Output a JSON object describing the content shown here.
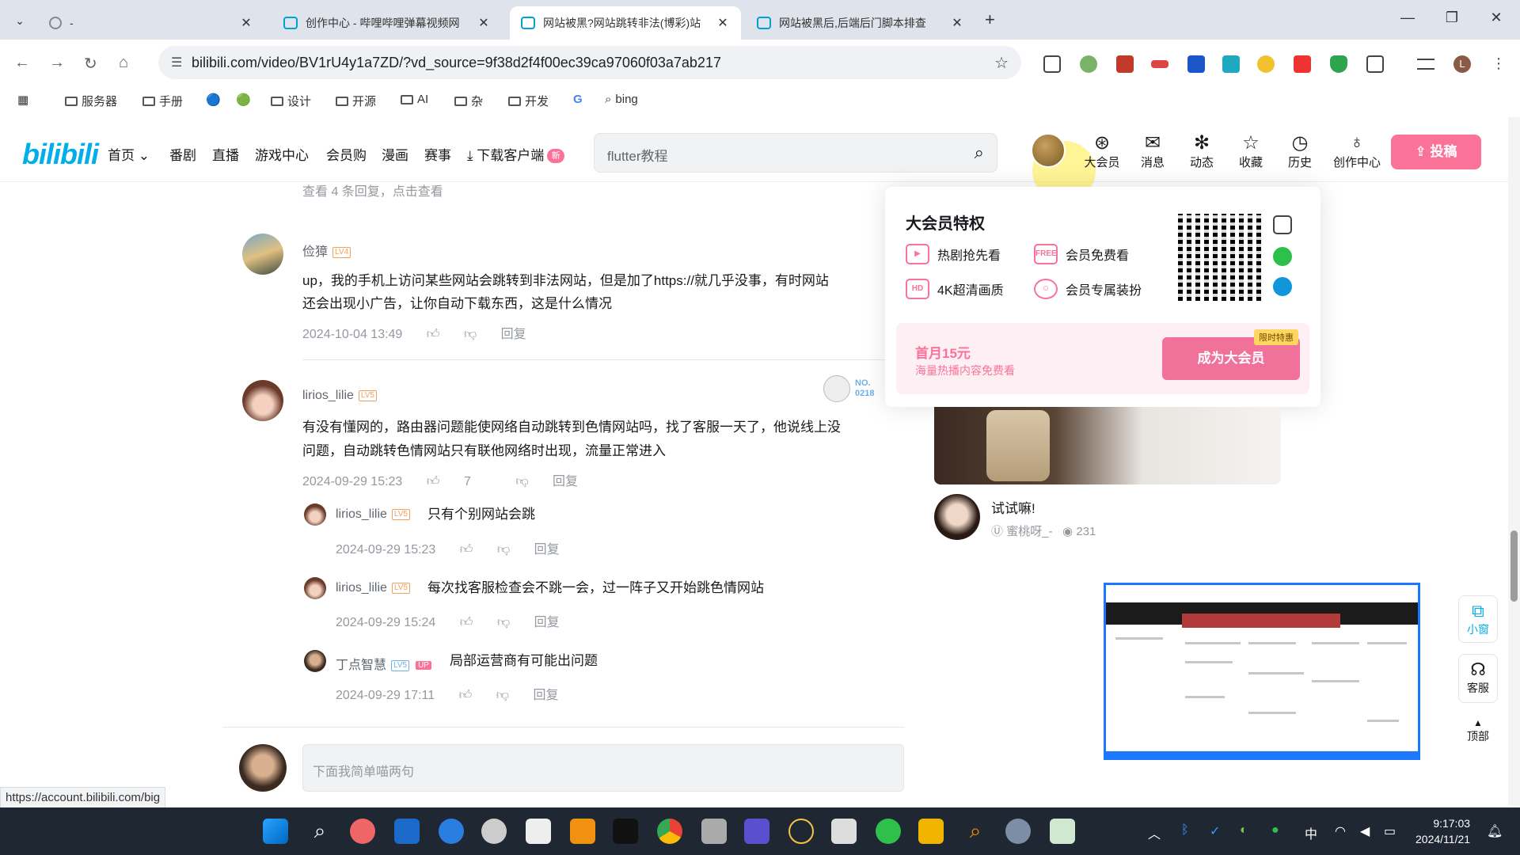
{
  "browser": {
    "tabs": [
      {
        "title": "-"
      },
      {
        "title": "创作中心 - 哔哩哔哩弹幕视频网"
      },
      {
        "title": "网站被黑?网站跳转非法(博彩)站"
      },
      {
        "title": "网站被黑后,后端后门脚本排查"
      }
    ],
    "url": "bilibili.com/video/BV1rU4y1a7ZD/?vd_source=9f38d2f4f00ec39ca97060f03a7ab217",
    "bookmarks": [
      "服务器",
      "手册",
      "设计",
      "开源",
      "AI",
      "杂",
      "开发",
      "bing"
    ],
    "status_url": "https://account.bilibili.com/big"
  },
  "site": {
    "nav": [
      "首页",
      "番剧",
      "直播",
      "游戏中心",
      "会员购",
      "漫画",
      "赛事",
      "下载客户端"
    ],
    "new_badge": "新",
    "search_placeholder": "flutter教程",
    "header_icons": [
      "大会员",
      "消息",
      "动态",
      "收藏",
      "历史",
      "创作中心"
    ],
    "upload_label": "投稿"
  },
  "comments": {
    "view_replies": "查看 4 条回复，点击查看",
    "items": [
      {
        "user": "俭獐",
        "level": "LV4",
        "text_line1": "up，我的手机上访问某些网站会跳转到非法网站，但是加了https://就几乎没事，有时网站",
        "text_line2": "还会出现小广告，让你自动下载东西，这是什么情况",
        "time": "2024-10-04 13:49",
        "reply": "回复"
      },
      {
        "user": "lirios_lilie",
        "level": "LV5",
        "text_line1": "有没有懂网的，路由器问题能使网络自动跳转到色情网站吗，找了客服一天了，他说线上没",
        "text_line2": "问题，自动跳转色情网站只有联他网络时出现，流量正常进入",
        "time": "2024-09-29 15:23",
        "likes": "7",
        "reply": "回复",
        "no_badge": "NO.",
        "no_num": "0218",
        "replies": [
          {
            "user": "lirios_lilie",
            "level": "LV5",
            "text": "只有个别网站会跳",
            "time": "2024-09-29 15:23",
            "reply": "回复"
          },
          {
            "user": "lirios_lilie",
            "level": "LV5",
            "text": "每次找客服检查会不跳一会，过一阵子又开始跳色情网站",
            "time": "2024-09-29 15:24",
            "reply": "回复"
          },
          {
            "user": "丁点智慧",
            "level": "LV5",
            "up": "UP",
            "text": "局部运营商有可能出问题",
            "time": "2024-09-29 17:11",
            "reply": "回复"
          }
        ]
      }
    ],
    "input_placeholder": "下面我简单喵两句"
  },
  "vip_popup": {
    "title": "大会员特权",
    "perks": [
      "热剧抢先看",
      "会员免费看",
      "4K超清画质",
      "会员专属装扮"
    ],
    "promo_title": "首月15元",
    "promo_sub": "海量热播内容免费看",
    "join_label": "成为大会员",
    "badge": "限时特惠"
  },
  "right": {
    "video_title": "试试嘛!",
    "video_author": "蜜桃呀_-",
    "video_views": "231",
    "side_tools": [
      "小窗",
      "客服",
      "顶部"
    ]
  },
  "taskbar": {
    "time": "9:17:03",
    "date": "2024/11/21",
    "ime": "中"
  },
  "colors": {
    "accent": "#00aeec",
    "pink": "#fb7299",
    "taskbar": "#1f2733"
  }
}
